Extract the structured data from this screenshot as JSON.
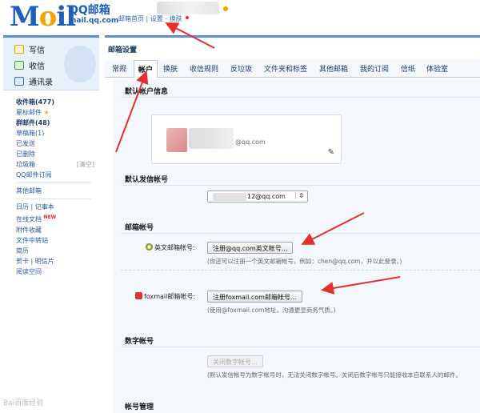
{
  "header": {
    "logo_text": "Mail",
    "logo_cn": "QQ邮箱",
    "logo_domain": "mail.qq.com",
    "nav_home": "邮箱首页",
    "nav_sep": " | ",
    "nav_settings": "设置",
    "nav_dash": " - ",
    "nav_skin": "换肤"
  },
  "sidebar": {
    "compose": "写信",
    "inbox": "收信",
    "contacts": "通讯录",
    "folders": [
      {
        "label": "收件箱(477)",
        "bold": true
      },
      {
        "label": "星标邮件",
        "star": "★"
      },
      {
        "label": "群邮件(48)",
        "bold": true
      },
      {
        "label": "草稿箱(1)"
      },
      {
        "label": "已发送"
      },
      {
        "label": "已删除"
      },
      {
        "label": "垃圾箱",
        "extra": "[清空]"
      },
      {
        "label": "QQ邮件订阅"
      }
    ],
    "other_mail": "其他邮箱",
    "calendar": "日历",
    "notes": "记事本",
    "online_docs": "在线文档",
    "new_tag": "NEW",
    "attachments": "附件收藏",
    "file_transfer": "文件中转站",
    "resume": "简历",
    "cards": "贺卡",
    "postcard": "明信片",
    "reading": "阅读空间"
  },
  "main": {
    "title": "邮箱设置",
    "tabs": [
      "常规",
      "帐户",
      "换肤",
      "收信规则",
      "反垃圾",
      "文件夹和标签",
      "其他邮箱",
      "我的订阅",
      "信纸",
      "体验室"
    ],
    "active_tab": "帐户",
    "default_account_title": "默认帐户信息",
    "account_email": "@qq.com",
    "default_sender_title": "默认发信帐号",
    "sender_value": "12@qq.com",
    "sender_arrow": "⇕",
    "mailbox_title": "邮箱帐号",
    "english_label": "英文邮箱帐号:",
    "english_button": "注册@qq.com英文帐号...",
    "english_hint": "(你还可以注册一个英文邮箱帐号，例如：chen@qq.com，并以此登录。)",
    "foxmail_label": "foxmail邮箱帐号:",
    "foxmail_button": "注册foxmail.com邮箱帐号...",
    "foxmail_hint": "(使用@foxmail.com地址，沟通更显商务气质。)",
    "digital_title": "数字帐号",
    "digital_button": "关闭数字帐号...",
    "digital_hint": "(默认发信帐号为数字帐号时，无法关闭数字帐号。关闭后数字帐号只能接收本自联系人的邮件。",
    "manage_title": "帐号管理"
  },
  "watermark": "Bai百度经验",
  "colors": {
    "brand_blue": "#1e5fbd",
    "accent_orange": "#f0a500",
    "annotation_red": "#e53030",
    "panel_bg": "#f4f8fd"
  }
}
